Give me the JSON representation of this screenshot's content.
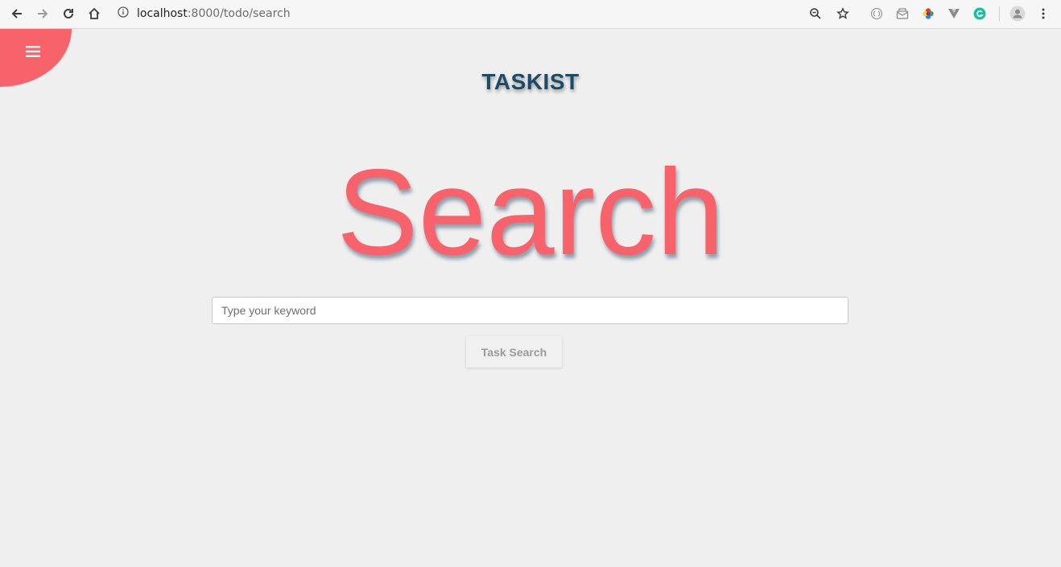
{
  "browser": {
    "url_host": "localhost",
    "url_path": ":8000/todo/search",
    "icons": [
      "back-icon",
      "forward-icon",
      "reload-icon",
      "home-icon",
      "info-icon",
      "zoom-icon",
      "star-icon",
      "extension-icons",
      "profile-icon",
      "more-icon"
    ]
  },
  "page": {
    "brand": "TASKIST",
    "heading": "Search",
    "search": {
      "placeholder": "Type your keyword",
      "value": ""
    },
    "search_button": "Task Search"
  },
  "colors": {
    "accent": "#f7626b",
    "brand": "#1d4a66",
    "background": "#efefef"
  }
}
